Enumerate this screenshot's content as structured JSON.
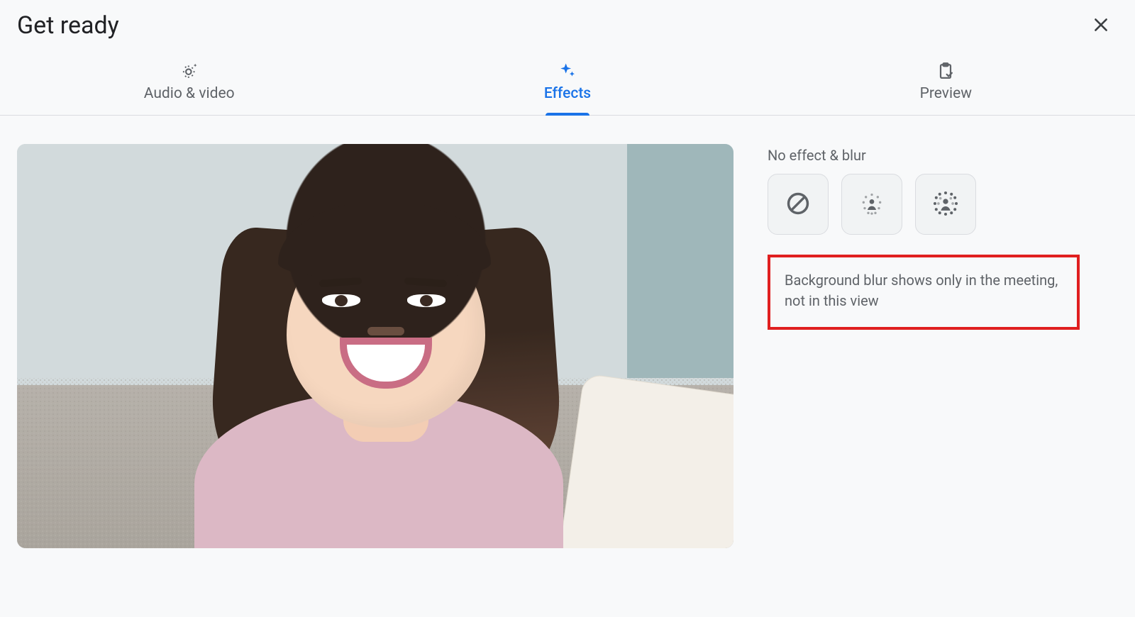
{
  "header": {
    "title": "Get ready"
  },
  "tabs": {
    "audio_video": {
      "label": "Audio & video",
      "icon": "settings-sparkle"
    },
    "effects": {
      "label": "Effects",
      "icon": "sparkle",
      "active": true
    },
    "preview": {
      "label": "Preview",
      "icon": "clipboard-check"
    }
  },
  "sidebar": {
    "section_label": "No effect & blur",
    "effects": {
      "none": {
        "icon": "no-effect"
      },
      "slight": {
        "icon": "slight-blur"
      },
      "full": {
        "icon": "full-blur"
      }
    },
    "notice_text": "Background blur shows only in the meeting, not in this view"
  },
  "colors": {
    "accent": "#1a73e8",
    "highlight_border": "#e01f1f"
  }
}
